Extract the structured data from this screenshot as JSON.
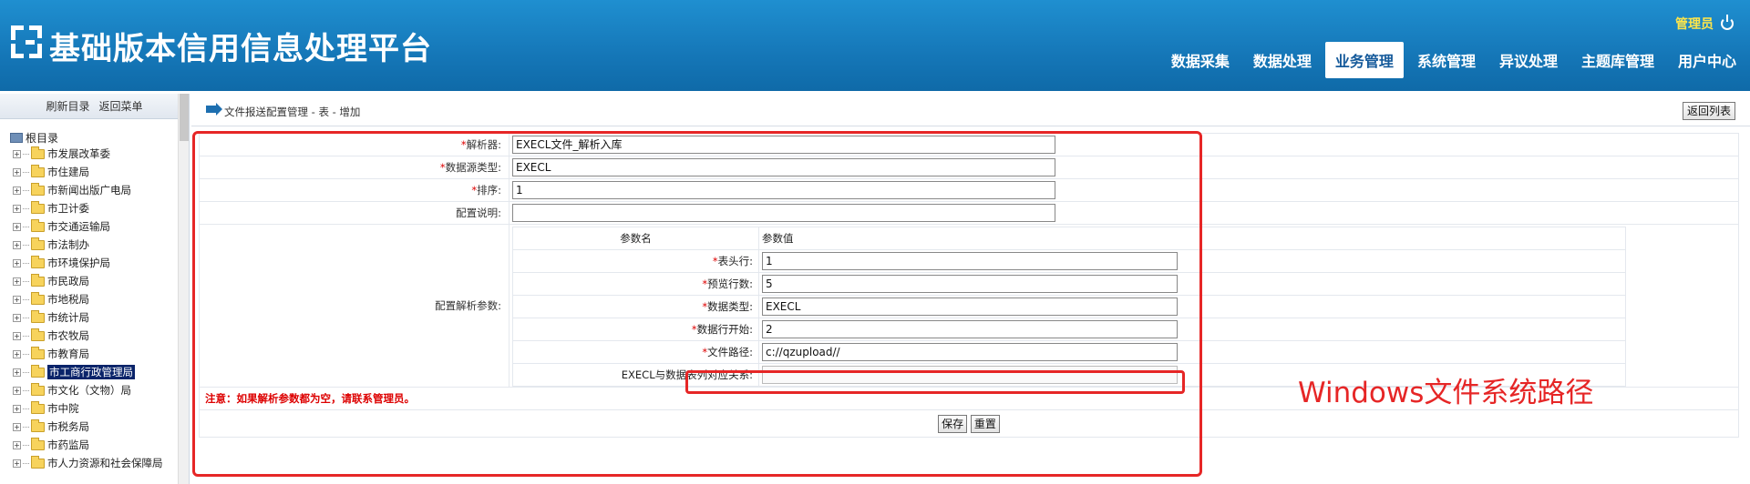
{
  "header": {
    "title": "基础版本信用信息处理平台",
    "user": "管理员",
    "nav": [
      {
        "label": "数据采集",
        "active": false
      },
      {
        "label": "数据处理",
        "active": false
      },
      {
        "label": "业务管理",
        "active": true
      },
      {
        "label": "系统管理",
        "active": false
      },
      {
        "label": "异议处理",
        "active": false
      },
      {
        "label": "主题库管理",
        "active": false
      },
      {
        "label": "用户中心",
        "active": false
      }
    ]
  },
  "sidebar": {
    "refresh": "刷新目录",
    "back_menu": "返回菜单",
    "root": "根目录",
    "items": [
      "市发展改革委",
      "市住建局",
      "市新闻出版广电局",
      "市卫计委",
      "市交通运输局",
      "市法制办",
      "市环境保护局",
      "市民政局",
      "市地税局",
      "市统计局",
      "市农牧局",
      "市教育局",
      "市工商行政管理局",
      "市文化（文物）局",
      "市中院",
      "市税务局",
      "市药监局",
      "市人力资源和社会保障局"
    ],
    "selected_index": 12
  },
  "main": {
    "breadcrumb": "文件报送配置管理 - 表 - 增加",
    "back_list": "返回列表",
    "fields": {
      "parser_label": "解析器:",
      "parser_value": "EXECL文件_解析入库",
      "source_type_label": "数据源类型:",
      "source_type_value": "EXECL",
      "sort_label": "排序:",
      "sort_value": "1",
      "desc_label": "配置说明:",
      "desc_value": ""
    },
    "params": {
      "section_label": "配置解析参数:",
      "col_name": "参数名",
      "col_value": "参数值",
      "rows": [
        {
          "label": "表头行:",
          "required": true,
          "value": "1"
        },
        {
          "label": "预览行数:",
          "required": true,
          "value": "5"
        },
        {
          "label": "数据类型:",
          "required": true,
          "value": "EXECL"
        },
        {
          "label": "数据行开始:",
          "required": true,
          "value": "2"
        },
        {
          "label": "文件路径:",
          "required": true,
          "value": "c://qzupload//"
        },
        {
          "label": "EXECL与数据表列对应关系:",
          "required": false,
          "value": ""
        }
      ]
    },
    "note": "注意：如果解析参数都为空，请联系管理员。",
    "save": "保存",
    "reset": "重置"
  },
  "annotation": "Windows文件系统路径"
}
